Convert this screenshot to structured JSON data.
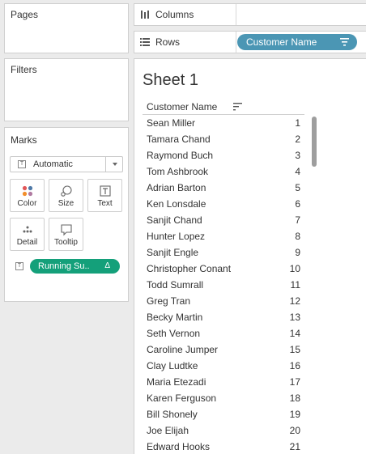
{
  "pages": {
    "title": "Pages"
  },
  "filters": {
    "title": "Filters"
  },
  "marks": {
    "title": "Marks",
    "mark_type": "Automatic",
    "buttons": {
      "color": "Color",
      "size": "Size",
      "text": "Text",
      "detail": "Detail",
      "tooltip": "Tooltip"
    },
    "pill": {
      "label": "Running Su..",
      "delta": "Δ",
      "color": "#14a07a"
    }
  },
  "shelves": {
    "columns_label": "Columns",
    "rows_label": "Rows",
    "rows_pill": {
      "label": "Customer Name",
      "color": "#4b96b4"
    }
  },
  "sheet": {
    "title": "Sheet 1",
    "column_header": "Customer Name",
    "rows": [
      {
        "name": "Sean Miller",
        "value": "1"
      },
      {
        "name": "Tamara Chand",
        "value": "2"
      },
      {
        "name": "Raymond Buch",
        "value": "3"
      },
      {
        "name": "Tom Ashbrook",
        "value": "4"
      },
      {
        "name": "Adrian Barton",
        "value": "5"
      },
      {
        "name": "Ken Lonsdale",
        "value": "6"
      },
      {
        "name": "Sanjit Chand",
        "value": "7"
      },
      {
        "name": "Hunter Lopez",
        "value": "8"
      },
      {
        "name": "Sanjit Engle",
        "value": "9"
      },
      {
        "name": "Christopher Conant",
        "value": "10"
      },
      {
        "name": "Todd Sumrall",
        "value": "11"
      },
      {
        "name": "Greg Tran",
        "value": "12"
      },
      {
        "name": "Becky Martin",
        "value": "13"
      },
      {
        "name": "Seth Vernon",
        "value": "14"
      },
      {
        "name": "Caroline Jumper",
        "value": "15"
      },
      {
        "name": "Clay Ludtke",
        "value": "16"
      },
      {
        "name": "Maria Etezadi",
        "value": "17"
      },
      {
        "name": "Karen Ferguson",
        "value": "18"
      },
      {
        "name": "Bill Shonely",
        "value": "19"
      },
      {
        "name": "Joe Elijah",
        "value": "20"
      },
      {
        "name": "Edward Hooks",
        "value": "21"
      }
    ]
  }
}
